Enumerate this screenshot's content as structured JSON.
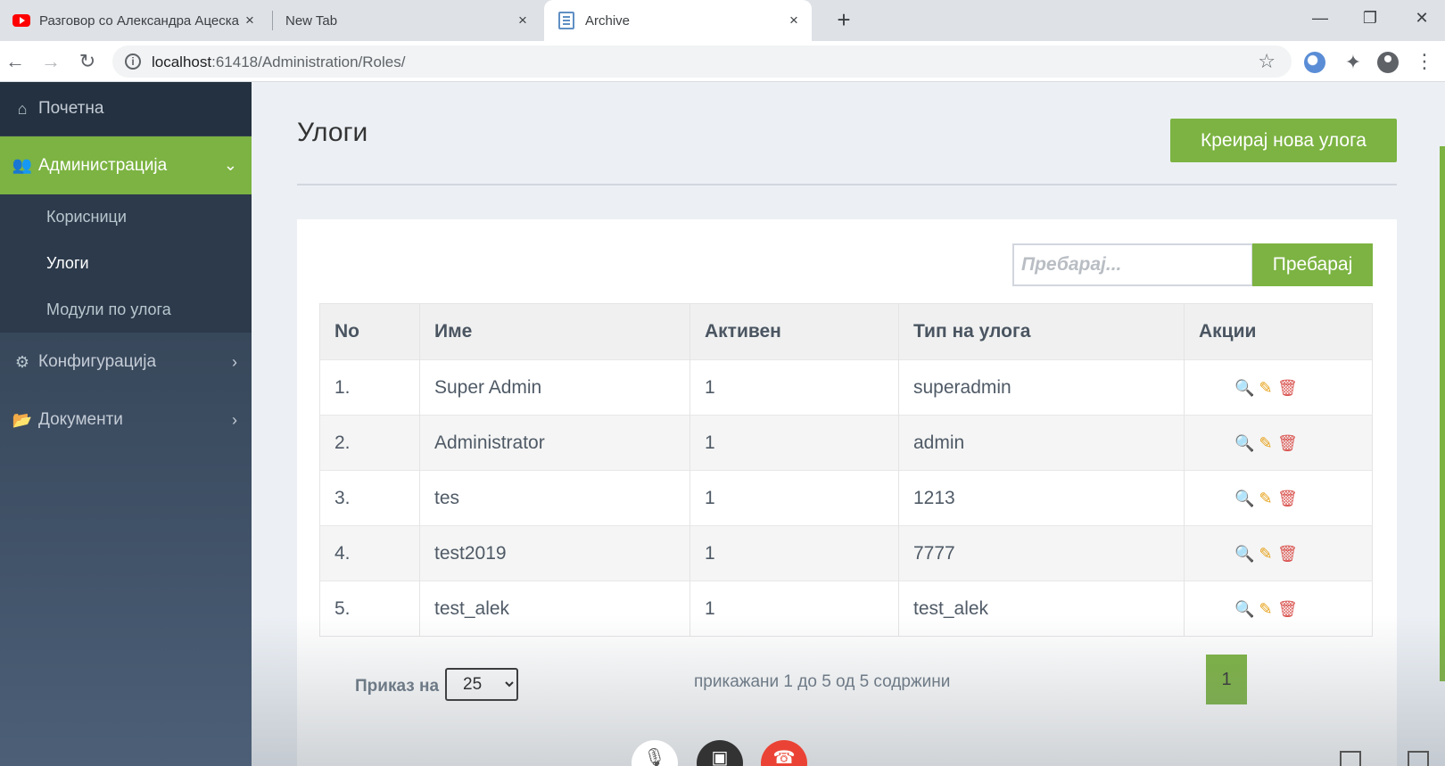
{
  "browser": {
    "tabs": [
      {
        "title": "Разговор со Александра Ацеска",
        "icon": "youtube-icon"
      },
      {
        "title": "New Tab"
      },
      {
        "title": "Archive",
        "icon": "document-icon"
      }
    ],
    "new_tab": "+",
    "close_glyph": "×",
    "window": {
      "minimize": "—",
      "restore": "❐",
      "close": "✕"
    },
    "nav": {
      "back": "←",
      "forward": "→",
      "reload": "↻"
    },
    "url_host": "localhost",
    "url_path": ":61418/Administration/Roles/",
    "star": "☆",
    "puzzle": "✦",
    "menu": "⋮"
  },
  "sidebar": {
    "home": {
      "label": "Почетна",
      "icon": "⌂"
    },
    "admin": {
      "label": "Администрација",
      "icon": "👥",
      "chevron": "⌄"
    },
    "admin_items": [
      "Корисници",
      "Улоги",
      "Модули по улога"
    ],
    "config": {
      "label": "Конфигурација",
      "icon": "⚙",
      "chevron": "›"
    },
    "docs": {
      "label": "Документи",
      "icon": "📂",
      "chevron": "›"
    }
  },
  "main": {
    "title": "Улоги",
    "create_button": "Креирај нова улога",
    "search": {
      "placeholder": "Пребарај...",
      "button": "Пребарај"
    },
    "table": {
      "headers": [
        "No",
        "Име",
        "Активен",
        "Тип на улога",
        "Акции"
      ],
      "rows": [
        [
          "1.",
          "Super Admin",
          "1",
          "superadmin"
        ],
        [
          "2.",
          "Administrator",
          "1",
          "admin"
        ],
        [
          "3.",
          "tes",
          "1",
          "1213"
        ],
        [
          "4.",
          "test2019",
          "1",
          "7777"
        ],
        [
          "5.",
          "test_alek",
          "1",
          "test_alek"
        ]
      ],
      "action_icons": {
        "view": "🔍",
        "edit": "✎",
        "delete": "🗑"
      }
    },
    "footer": {
      "page_size_label": "Приказ на",
      "page_size": "25",
      "info": "прикажани 1 до 5 од 5 содржини",
      "page": "1"
    }
  },
  "call_controls": {
    "mic": "🎙",
    "camera": "▣",
    "hangup": "☎"
  },
  "colors": {
    "accent": "#7cb342",
    "sidebar": "#2f3b4a"
  }
}
